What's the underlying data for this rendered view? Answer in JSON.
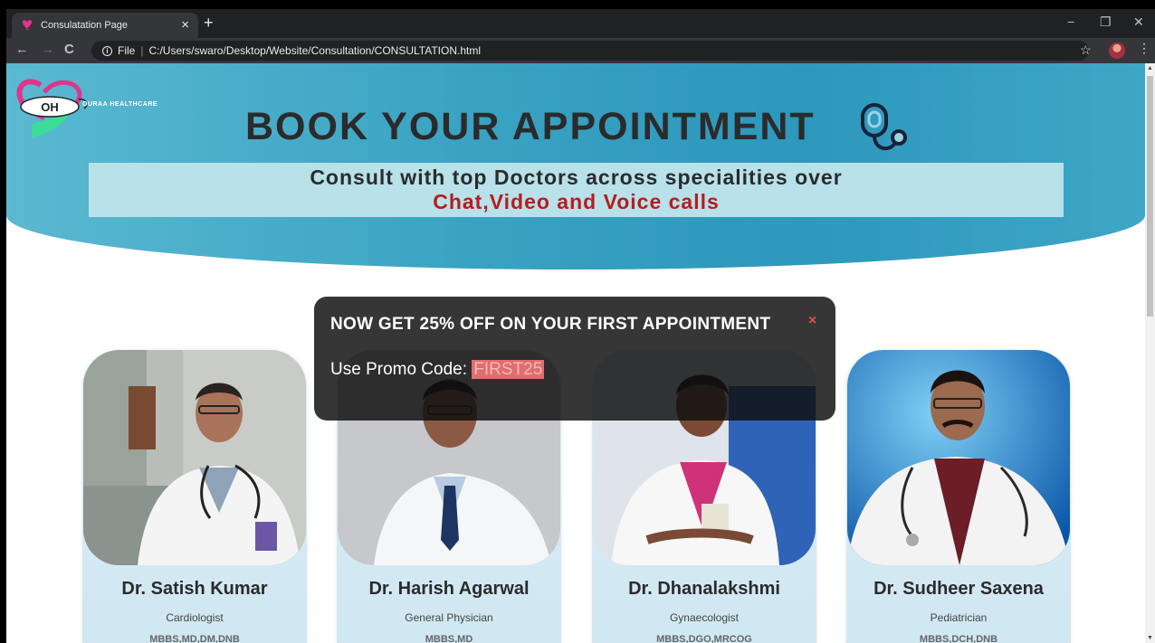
{
  "browser": {
    "tab_title": "Consulatation Page",
    "tab_close": "×",
    "new_tab": "+",
    "url_scheme": "File",
    "url": "C:/Users/swaro/Desktop/Website/Consultation/CONSULTATION.html",
    "minimize": "−",
    "restore": "❐",
    "close": "✕",
    "back": "←",
    "forward": "→",
    "reload": "C",
    "bookmark": "☆",
    "menu": "⋮"
  },
  "header": {
    "logo_initials": "OH",
    "logo_text": "OURAA HEALTHCARE",
    "title": "BOOK YOUR APPOINTMENT",
    "subtitle_line1": "Consult with top Doctors across specialities over",
    "subtitle_line2": "Chat,Video and Voice calls",
    "colors": {
      "banner": "#3aa3c3",
      "accent_red": "#b71d1d",
      "logo_pink": "#e0358a"
    }
  },
  "promo": {
    "title": "NOW GET 25% OFF ON YOUR FIRST APPOINTMENT",
    "close": "×",
    "prefix": "Use Promo Code: ",
    "code": "FIRST25"
  },
  "doctors": [
    {
      "name": "Dr. Satish Kumar",
      "specialty": "Cardiologist",
      "degrees": "MBBS,MD,DM,DNB"
    },
    {
      "name": "Dr. Harish Agarwal",
      "specialty": "General Physician",
      "degrees": "MBBS,MD"
    },
    {
      "name": "Dr. Dhanalakshmi",
      "specialty": "Gynaecologist",
      "degrees": "MBBS,DGO,MRCOG"
    },
    {
      "name": "Dr. Sudheer Saxena",
      "specialty": "Pediatrician",
      "degrees": "MBBS,DCH,DNB"
    }
  ]
}
